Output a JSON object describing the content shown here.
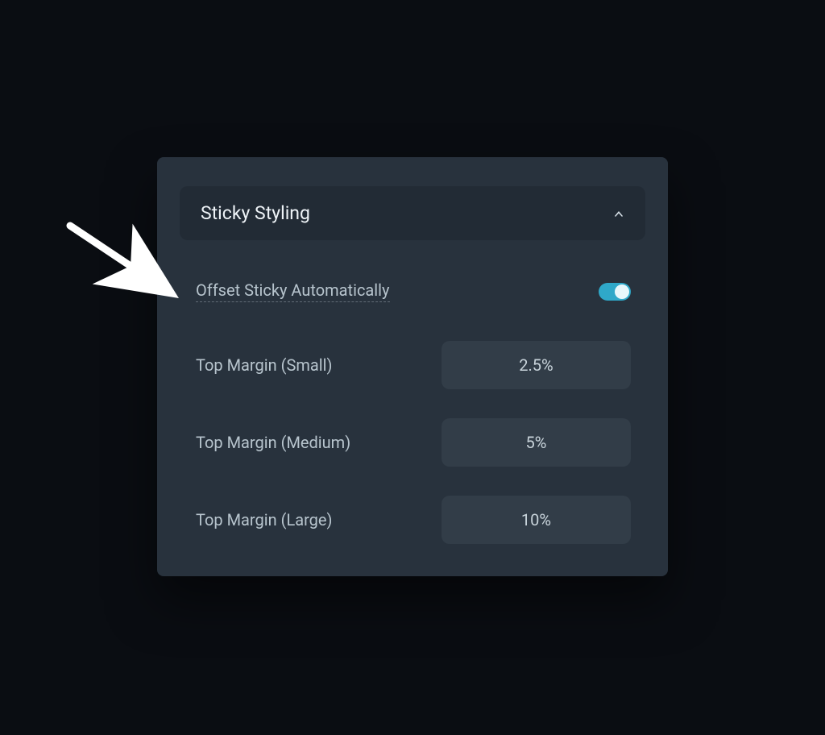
{
  "panel": {
    "header_title": "Sticky Styling",
    "toggle": {
      "label": "Offset Sticky Automatically",
      "on": true
    },
    "rows": [
      {
        "label": "Top Margin (Small)",
        "value": "2.5%"
      },
      {
        "label": "Top Margin (Medium)",
        "value": "5%"
      },
      {
        "label": "Top Margin (Large)",
        "value": "10%"
      }
    ]
  }
}
